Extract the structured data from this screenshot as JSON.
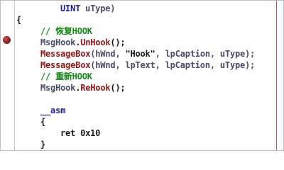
{
  "code_lines": [
    {
      "parts": [
        "UINT",
        " uType)"
      ]
    },
    {
      "parts": [
        "{"
      ]
    },
    {
      "parts": [
        "// 恢复HOOK"
      ]
    },
    {
      "parts": [
        "MsgHook",
        ".",
        "UnHook",
        "();"
      ]
    },
    {
      "parts": [
        "MessageBox",
        "(hWnd, ",
        "\"Hook\"",
        ", lpCaption, uType);"
      ]
    },
    {
      "parts": [
        "MessageBox",
        "(hWnd, lpText, lpCaption, uType);"
      ]
    },
    {
      "parts": [
        "// 重新HOOK"
      ]
    },
    {
      "parts": [
        "MsgHook",
        ".",
        "ReHook",
        "();"
      ]
    },
    {
      "parts": [
        "__asm"
      ]
    },
    {
      "parts": [
        "{"
      ]
    },
    {
      "parts": [
        "ret 0x10"
      ]
    },
    {
      "parts": [
        "}"
      ]
    }
  ],
  "colors": {
    "keyword": "#2020a0",
    "function": "#9a1414",
    "comment": "#138a13",
    "breakpoint": "#8a1f1f"
  }
}
